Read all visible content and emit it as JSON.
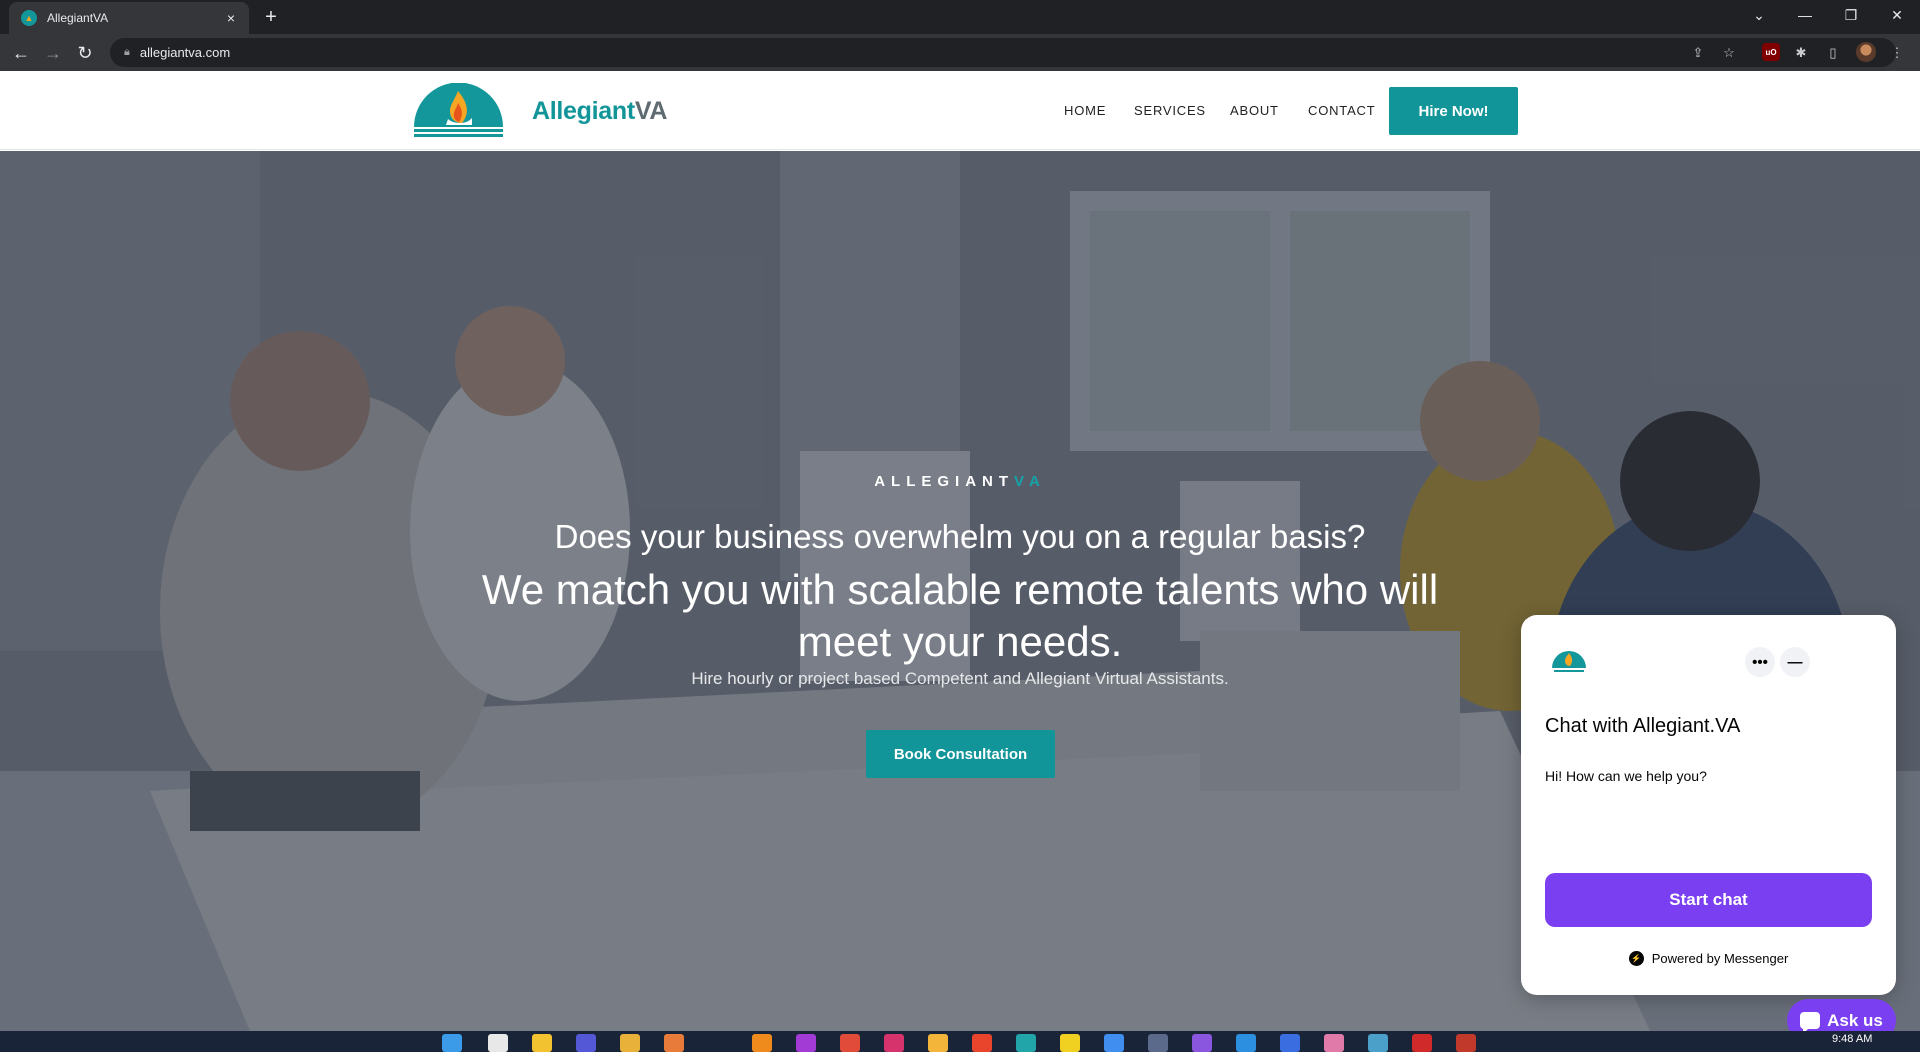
{
  "browser": {
    "tab_title": "AllegiantVA",
    "url": "allegiantva.com",
    "new_tab": "+",
    "tab_close": "×"
  },
  "site": {
    "brand": {
      "main": "Allegiant",
      "suffix": "VA"
    },
    "nav": {
      "home": "HOME",
      "services": "SERVICES",
      "about": "ABOUT",
      "contact": "CONTACT"
    },
    "hire_button": "Hire Now!",
    "hero": {
      "eyebrow_main": "ALLEGIANT",
      "eyebrow_suffix": "VA",
      "question": "Does your business overwhelm you on a regular basis?",
      "headline": "We match you with scalable remote talents who will meet your needs.",
      "description": "Hire hourly or project based Competent and Allegiant Virtual Assistants.",
      "cta": "Book Consultation"
    },
    "colors": {
      "accent": "#119599",
      "messenger": "#7b3ff2"
    }
  },
  "chat": {
    "title": "Chat with Allegiant.VA",
    "message": "Hi! How can we help you?",
    "start_button": "Start chat",
    "powered_by": "Powered by Messenger",
    "more_icon": "•••",
    "minimize_icon": "—"
  },
  "ask_us": "Ask us",
  "taskbar": {
    "time": "9:48 AM"
  }
}
